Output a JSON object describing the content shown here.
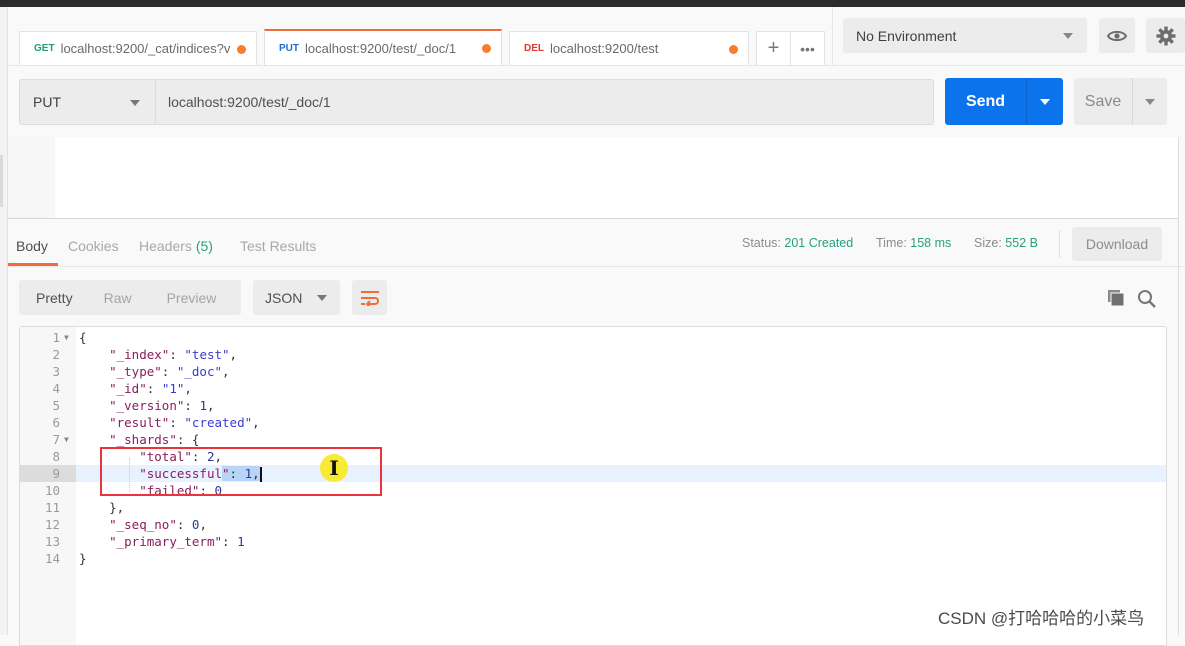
{
  "tabs": [
    {
      "method": "GET",
      "method_color": "#1fa06b",
      "url": "localhost:9200/_cat/indices?v",
      "unsaved": true,
      "active": false
    },
    {
      "method": "PUT",
      "method_color": "#1f6fd6",
      "url": "localhost:9200/test/_doc/1",
      "unsaved": true,
      "active": true
    },
    {
      "method": "DEL",
      "method_color": "#e0372f",
      "url": "localhost:9200/test",
      "unsaved": true,
      "active": false
    }
  ],
  "tab_actions": {
    "new_tab_icon": "plus-icon",
    "more_icon": "ellipsis-icon"
  },
  "environment": {
    "selected": "No Environment",
    "eye_icon": "eye-icon",
    "settings_icon": "gear-icon"
  },
  "request": {
    "method": "PUT",
    "url": "localhost:9200/test/_doc/1",
    "send_label": "Send",
    "save_label": "Save"
  },
  "response": {
    "tabs": [
      {
        "label": "Body",
        "active": true
      },
      {
        "label": "Cookies",
        "active": false
      },
      {
        "label": "Headers",
        "count": "(5)",
        "active": false
      },
      {
        "label": "Test Results",
        "active": false
      }
    ],
    "status_label": "Status:",
    "status_value": "201 Created",
    "time_label": "Time:",
    "time_value": "158 ms",
    "size_label": "Size:",
    "size_value": "552 B",
    "download_label": "Download",
    "views": [
      "Pretty",
      "Raw",
      "Preview"
    ],
    "active_view": "Pretty",
    "format": "JSON",
    "accent_color": "#f26b3a",
    "status_color": "#26a17f"
  },
  "code": {
    "lines": [
      {
        "n": "1",
        "fold": true
      },
      {
        "n": "2"
      },
      {
        "n": "3"
      },
      {
        "n": "4"
      },
      {
        "n": "5"
      },
      {
        "n": "6"
      },
      {
        "n": "7",
        "fold": true
      },
      {
        "n": "8"
      },
      {
        "n": "9",
        "highlighted": true
      },
      {
        "n": "10"
      },
      {
        "n": "11"
      },
      {
        "n": "12"
      },
      {
        "n": "13"
      },
      {
        "n": "14"
      }
    ],
    "tokens": {
      "open": "{",
      "index_key": "\"_index\"",
      "index_val": "\"test\"",
      "type_key": "\"_type\"",
      "type_val": "\"_doc\"",
      "id_key": "\"_id\"",
      "id_val": "\"1\"",
      "version_key": "\"_version\"",
      "version_val": "1",
      "result_key": "\"result\"",
      "result_val": "\"created\"",
      "shards_key": "\"_shards\"",
      "total_key": "\"total\"",
      "total_val": "2",
      "successful_key_a": "\"successful",
      "successful_key_b": "\"",
      "successful_val": "1",
      "failed_key": "\"failed\"",
      "failed_val": "0",
      "seq_key": "\"_seq_no\"",
      "seq_val": "0",
      "term_key": "\"_primary_term\"",
      "term_val": "1",
      "close": "}"
    }
  },
  "annotation": {
    "box_color": "#e8343a",
    "cursor_glyph": "I"
  },
  "watermark": "CSDN @打哈哈哈的小菜鸟"
}
